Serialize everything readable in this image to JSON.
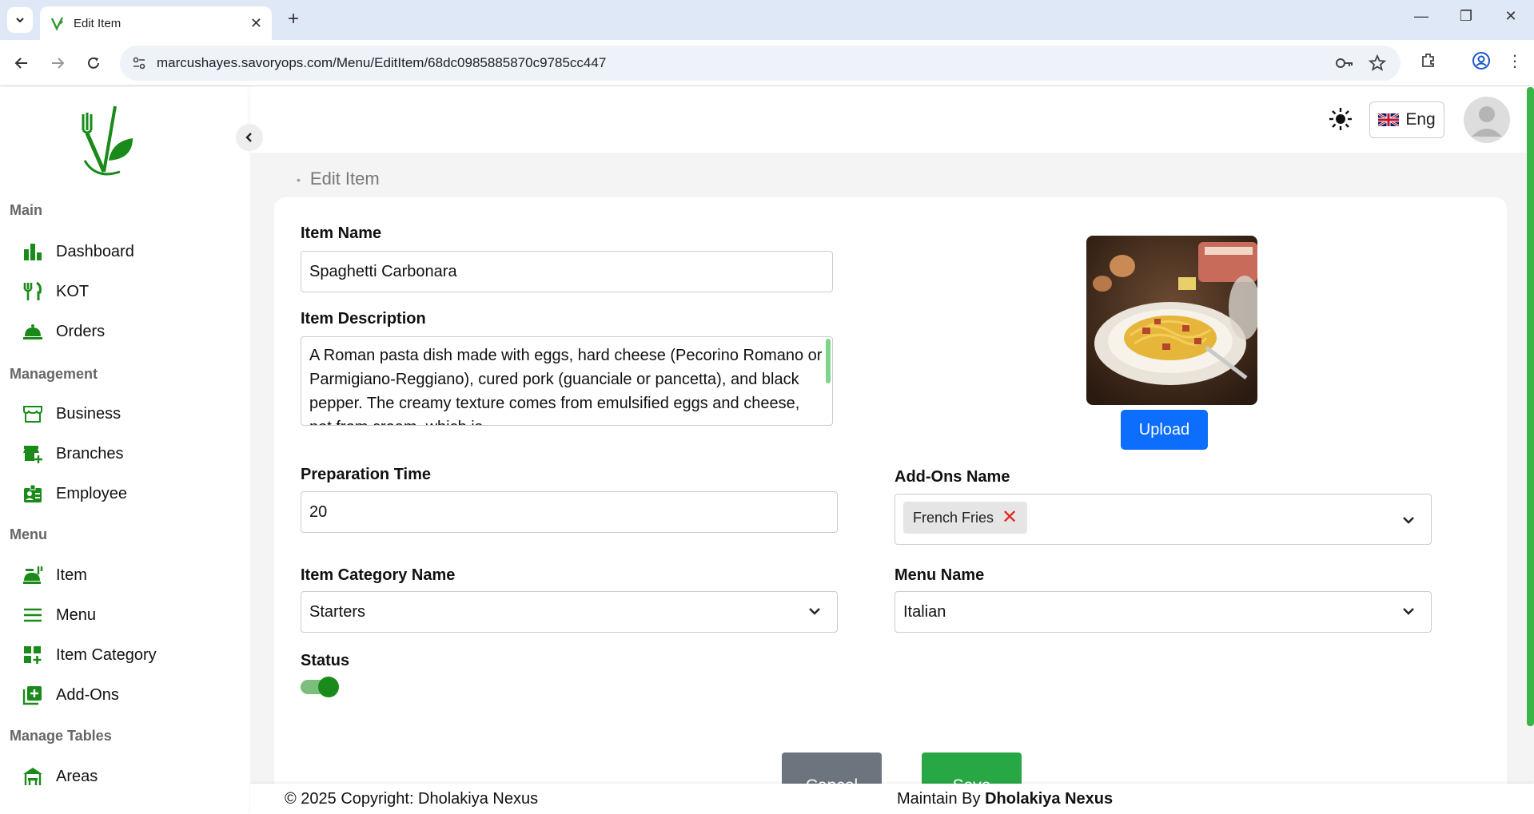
{
  "browser": {
    "tab_title": "Edit Item",
    "url": "marcushayes.savoryops.com/Menu/EditItem/68dc0985885870c9785cc447"
  },
  "sidebar": {
    "sections": {
      "main": "Main",
      "management": "Management",
      "menu": "Menu",
      "tables": "Manage Tables"
    },
    "items": {
      "dashboard": "Dashboard",
      "kot": "KOT",
      "orders": "Orders",
      "business": "Business",
      "branches": "Branches",
      "employee": "Employee",
      "item": "Item",
      "menu": "Menu",
      "item_category": "Item Category",
      "addons": "Add-Ons",
      "areas": "Areas"
    }
  },
  "topbar": {
    "language": "Eng"
  },
  "page": {
    "breadcrumb": "Edit Item"
  },
  "form": {
    "item_name_label": "Item Name",
    "item_name_value": "Spaghetti Carbonara",
    "item_description_label": "Item Description",
    "item_description_value": "A Roman pasta dish made with eggs, hard cheese (Pecorino Romano or Parmigiano-Reggiano), cured pork (guanciale or pancetta), and black pepper. The creamy texture comes from emulsified eggs and cheese, not from cream, which is",
    "upload_label": "Upload",
    "prep_time_label": "Preparation Time",
    "prep_time_value": "20",
    "addons_label": "Add-Ons Name",
    "addon_chip": "French Fries",
    "item_category_label": "Item Category Name",
    "item_category_value": "Starters",
    "menu_name_label": "Menu Name",
    "menu_name_value": "Italian",
    "status_label": "Status",
    "status_on": true,
    "cancel_label": "Cancel",
    "save_label": "Save"
  },
  "footer": {
    "copyright": "© 2025 Copyright: Dholakiya Nexus",
    "maintain_prefix": "Maintain By ",
    "maintain_name": "Dholakiya Nexus"
  },
  "colors": {
    "brand_green": "#1a8a1a",
    "primary_blue": "#0d6efd",
    "save_green": "#28a745",
    "cancel_gray": "#6c757d"
  }
}
